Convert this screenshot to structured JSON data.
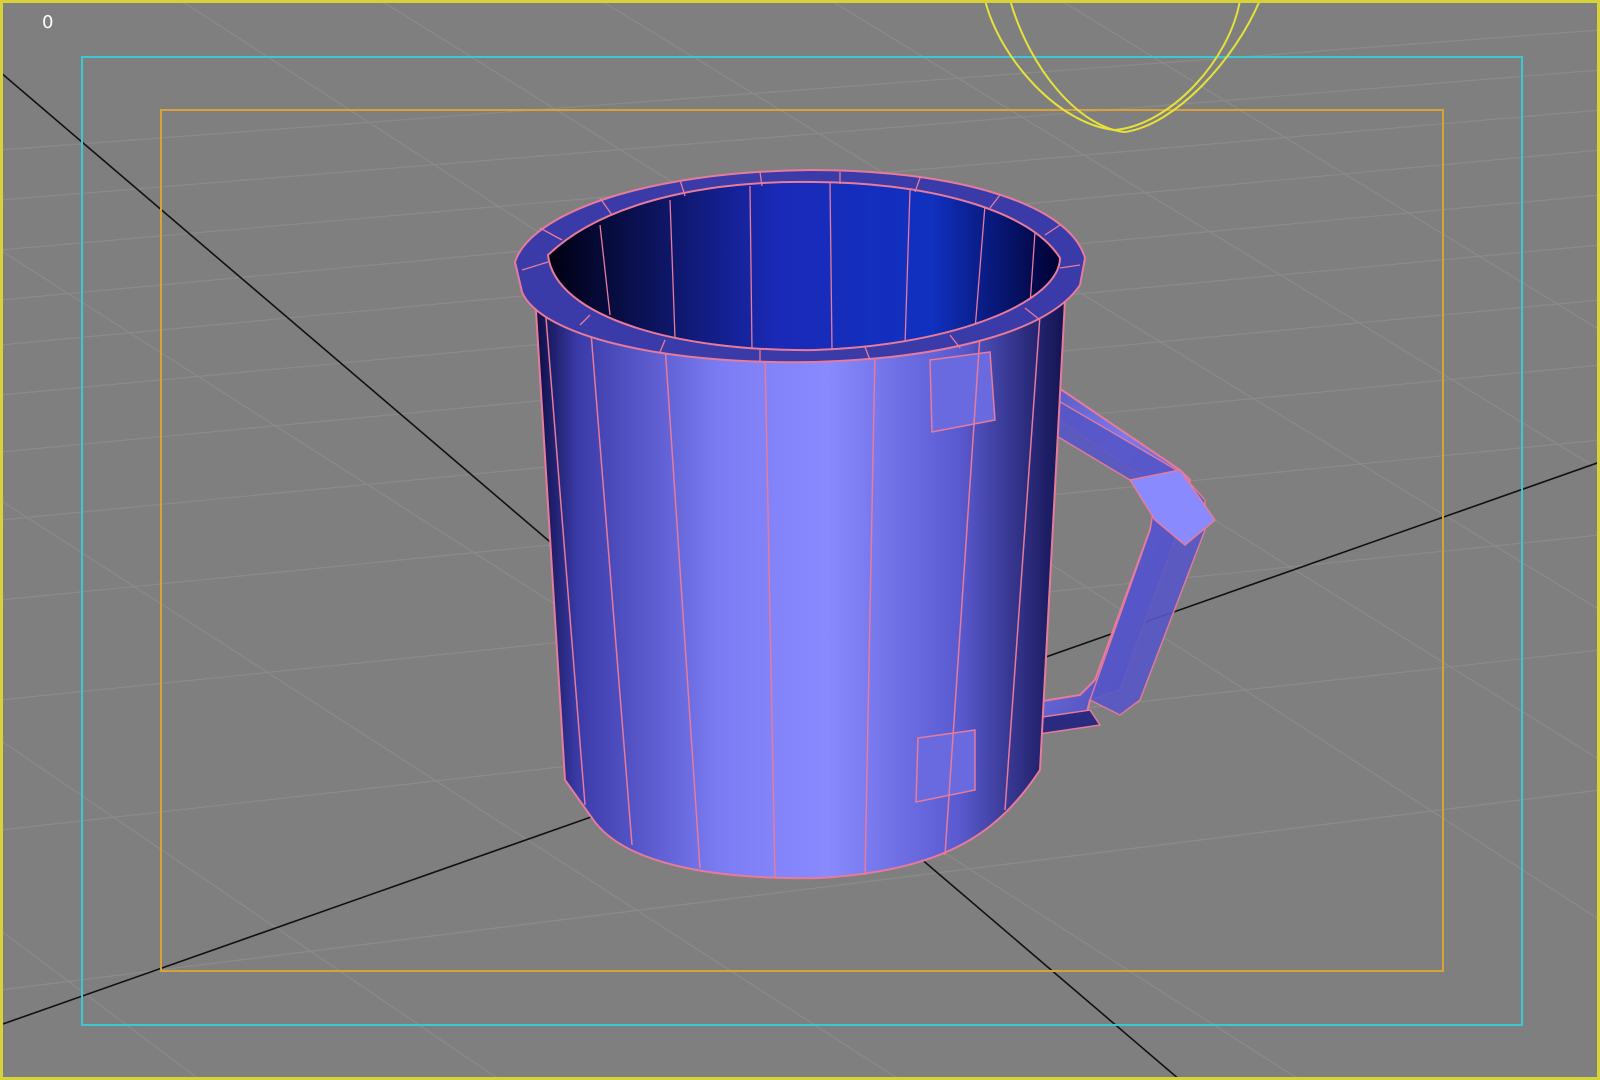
{
  "viewport": {
    "frame_number": "0",
    "colors": {
      "background": "#7f7f7f",
      "active_border": "#d6d23a",
      "grid_line": "#8c8c8c",
      "world_axis": "#111111",
      "safe_frame_outer": "#3cc8d2",
      "safe_frame_inner": "#d6a23a",
      "light_gizmo": "#e6e23a",
      "mesh_wire": "#e87a9a",
      "mesh_face_light": "#8a8aff",
      "mesh_face_dark": "#1a1a66",
      "label_text": "#ffffff"
    }
  },
  "scene": {
    "object_icon": "mug-mesh-icon",
    "light_icon": "light-gizmo-icon"
  }
}
